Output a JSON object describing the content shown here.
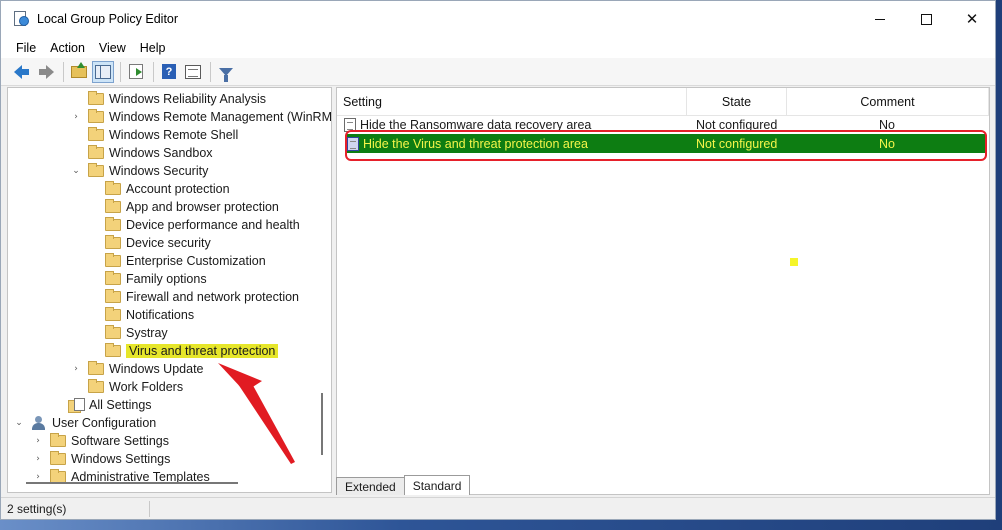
{
  "window": {
    "title": "Local Group Policy Editor",
    "controls": {
      "minimize": "",
      "maximize": "",
      "close": "✕"
    }
  },
  "menu": [
    "File",
    "Action",
    "View",
    "Help"
  ],
  "toolbar": {
    "icons": [
      "back-arrow-icon",
      "forward-arrow-icon",
      "up-folder-icon",
      "show-hide-tree-icon",
      "export-list-icon",
      "help-icon",
      "properties-icon",
      "filter-icon"
    ]
  },
  "tree": {
    "items": [
      {
        "label": "Windows Reliability Analysis",
        "expander": ""
      },
      {
        "label": "Windows Remote Management (WinRM)",
        "expander": "›"
      },
      {
        "label": "Windows Remote Shell",
        "expander": ""
      },
      {
        "label": "Windows Sandbox",
        "expander": ""
      },
      {
        "label": "Windows Security",
        "expander": "⌄"
      },
      {
        "label": "Account protection",
        "expander": ""
      },
      {
        "label": "App and browser protection",
        "expander": ""
      },
      {
        "label": "Device performance and health",
        "expander": ""
      },
      {
        "label": "Device security",
        "expander": ""
      },
      {
        "label": "Enterprise Customization",
        "expander": ""
      },
      {
        "label": "Family options",
        "expander": ""
      },
      {
        "label": "Firewall and network protection",
        "expander": ""
      },
      {
        "label": "Notifications",
        "expander": ""
      },
      {
        "label": "Systray",
        "expander": ""
      },
      {
        "label": "Virus and threat protection",
        "expander": ""
      },
      {
        "label": "Windows Update",
        "expander": "›"
      },
      {
        "label": "Work Folders",
        "expander": ""
      },
      {
        "label": "All Settings",
        "expander": ""
      },
      {
        "label": "User Configuration",
        "expander": "⌄"
      },
      {
        "label": "Software Settings",
        "expander": "›"
      },
      {
        "label": "Windows Settings",
        "expander": "›"
      },
      {
        "label": "Administrative Templates",
        "expander": "›"
      }
    ]
  },
  "list": {
    "columns": [
      "Setting",
      "State",
      "Comment"
    ],
    "rows": [
      {
        "setting": "Hide the Ransomware data recovery area",
        "state": "Not configured",
        "comment": "No"
      },
      {
        "setting": "Hide the Virus and threat protection area",
        "state": "Not configured",
        "comment": "No"
      }
    ]
  },
  "tabs": [
    "Extended",
    "Standard"
  ],
  "status": {
    "text": "2 setting(s)"
  },
  "colors": {
    "selected_row_bg": "#0d7d12",
    "selected_row_text": "#f5f54a",
    "highlight_outline": "#e6202a",
    "tree_highlight": "#e6e62a"
  }
}
